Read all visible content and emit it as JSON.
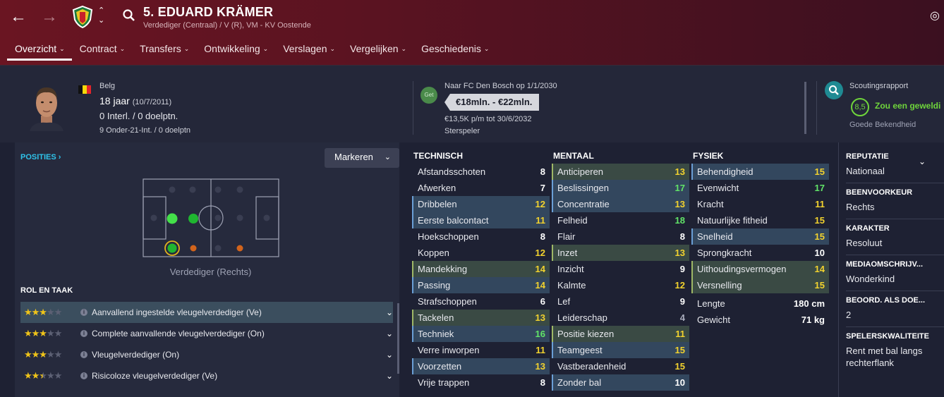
{
  "header": {
    "back_icon": "arrow-left-icon",
    "forward_icon": "arrow-right-icon",
    "player_name": "5. EDUARD KRÄMER",
    "player_sub": "Verdediger (Centraal) / V (R), VM - KV Oostende",
    "accent_color": "#5a1321"
  },
  "tabs": [
    {
      "label": "Overzicht",
      "active": true
    },
    {
      "label": "Contract"
    },
    {
      "label": "Transfers"
    },
    {
      "label": "Ontwikkeling"
    },
    {
      "label": "Verslagen"
    },
    {
      "label": "Vergelijken"
    },
    {
      "label": "Geschiedenis"
    }
  ],
  "profile": {
    "nationality": "Belg",
    "age": "18 jaar",
    "dob": "(10/7/2011)",
    "caps": "0 Interl. / 0 doelptn.",
    "u21": "9 Onder-21-Int. / 0 doelptn"
  },
  "transfer": {
    "get_label": "Get",
    "destination": "Naar FC Den Bosch op 1/1/2030",
    "value": "€18mln. - €22mln.",
    "wage": "€13,5K p/m tot 30/6/2032",
    "status": "Sterspeler"
  },
  "scouting": {
    "title": "Scoutingsrapport",
    "rating": "8,5",
    "verdict": "Zou een geweldi",
    "knowledge": "Goede Bekendheid"
  },
  "positions": {
    "link": "POSITIES ›",
    "mark_button": "Markeren",
    "label": "Verdediger (Rechts)"
  },
  "roles": {
    "title": "ROL EN TAAK",
    "items": [
      {
        "name": "Aanvallend ingestelde vleugelverdediger (Ve)",
        "stars": 3.0,
        "selected": true
      },
      {
        "name": "Complete aanvallende vleugelverdediger (On)",
        "stars": 3.0
      },
      {
        "name": "Vleugelverdediger (On)",
        "stars": 3.0
      },
      {
        "name": "Risicoloze vleugelverdediger (Ve)",
        "stars": 2.5
      }
    ]
  },
  "technisch": {
    "title": "TECHNISCH",
    "rows": [
      {
        "name": "Afstandsschoten",
        "value": "8",
        "hl": ""
      },
      {
        "name": "Afwerken",
        "value": "7",
        "hl": ""
      },
      {
        "name": "Dribbelen",
        "value": "12",
        "hl": "blue"
      },
      {
        "name": "Eerste balcontact",
        "value": "11",
        "hl": "blue"
      },
      {
        "name": "Hoekschoppen",
        "value": "8",
        "hl": ""
      },
      {
        "name": "Koppen",
        "value": "12",
        "hl": ""
      },
      {
        "name": "Mandekking",
        "value": "14",
        "hl": "green"
      },
      {
        "name": "Passing",
        "value": "14",
        "hl": "blue"
      },
      {
        "name": "Strafschoppen",
        "value": "6",
        "hl": ""
      },
      {
        "name": "Tackelen",
        "value": "13",
        "hl": "green"
      },
      {
        "name": "Techniek",
        "value": "16",
        "hl": "blue"
      },
      {
        "name": "Verre inworpen",
        "value": "11",
        "hl": ""
      },
      {
        "name": "Voorzetten",
        "value": "13",
        "hl": "blue"
      },
      {
        "name": "Vrije trappen",
        "value": "8",
        "hl": ""
      }
    ]
  },
  "mentaal": {
    "title": "MENTAAL",
    "rows": [
      {
        "name": "Anticiperen",
        "value": "13",
        "hl": "green"
      },
      {
        "name": "Beslissingen",
        "value": "17",
        "hl": "blue"
      },
      {
        "name": "Concentratie",
        "value": "13",
        "hl": "blue"
      },
      {
        "name": "Felheid",
        "value": "18",
        "hl": ""
      },
      {
        "name": "Flair",
        "value": "8",
        "hl": ""
      },
      {
        "name": "Inzet",
        "value": "13",
        "hl": "green"
      },
      {
        "name": "Inzicht",
        "value": "9",
        "hl": ""
      },
      {
        "name": "Kalmte",
        "value": "12",
        "hl": ""
      },
      {
        "name": "Lef",
        "value": "9",
        "hl": ""
      },
      {
        "name": "Leiderschap",
        "value": "4",
        "hl": ""
      },
      {
        "name": "Positie kiezen",
        "value": "11",
        "hl": "green"
      },
      {
        "name": "Teamgeest",
        "value": "15",
        "hl": "blue"
      },
      {
        "name": "Vastberadenheid",
        "value": "15",
        "hl": ""
      },
      {
        "name": "Zonder bal",
        "value": "10",
        "hl": "blue"
      }
    ]
  },
  "fysiek": {
    "title": "FYSIEK",
    "rows": [
      {
        "name": "Behendigheid",
        "value": "15",
        "hl": "blue"
      },
      {
        "name": "Evenwicht",
        "value": "17",
        "hl": ""
      },
      {
        "name": "Kracht",
        "value": "11",
        "hl": ""
      },
      {
        "name": "Natuurlijke fitheid",
        "value": "15",
        "hl": ""
      },
      {
        "name": "Snelheid",
        "value": "15",
        "hl": "blue"
      },
      {
        "name": "Sprongkracht",
        "value": "10",
        "hl": ""
      },
      {
        "name": "Uithoudingsvermogen",
        "value": "14",
        "hl": "green"
      },
      {
        "name": "Versnelling",
        "value": "15",
        "hl": "green"
      }
    ],
    "extra": [
      {
        "name": "Lengte",
        "value": "180 cm"
      },
      {
        "name": "Gewicht",
        "value": "71 kg"
      }
    ]
  },
  "side": {
    "reputation_label": "REPUTATIE",
    "reputation": "Nationaal",
    "foot_label": "BEENVOORKEUR",
    "foot": "Rechts",
    "character_label": "KARAKTER",
    "character": "Resoluut",
    "media_label": "MEDIAOMSCHRIJV...",
    "media": "Wonderkind",
    "rating_label": "BEOORD. ALS DOE...",
    "rating": "2",
    "quality_label": "SPELERSKWALITEITE",
    "quality": "Rent met bal langs rechterflank"
  }
}
